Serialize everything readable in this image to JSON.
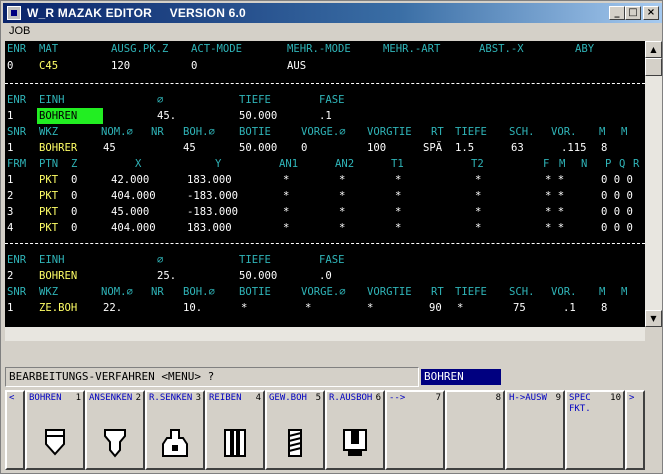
{
  "window": {
    "title": "W_R MAZAK EDITOR     VERSION 6.0",
    "min_glyph": "_",
    "max_glyph": "□",
    "close_glyph": "×"
  },
  "menu": {
    "job": "JOB"
  },
  "header": {
    "labels": [
      "ENR",
      "MAT",
      "AUSG.PK.Z",
      "ACT-MODE",
      "MEHR.-MODE",
      "MEHR.-ART",
      "ABST.-X",
      "ABY"
    ],
    "values": [
      "0",
      "C45",
      "120",
      "0",
      "AUS"
    ]
  },
  "unit1": {
    "head_labels": [
      "ENR",
      "EINH",
      "⌀",
      "TIEFE",
      "FASE"
    ],
    "head_values": [
      "1",
      "BOHREN",
      "45.",
      "50.000",
      ".1"
    ],
    "tool_labels": [
      "SNR",
      "WKZ",
      "NOM.⌀",
      "NR",
      "BOH.⌀",
      "BOTIE",
      "VORGE.⌀",
      "VORGTIE",
      "RT",
      "TIEFE",
      "SCH.",
      "VOR.",
      "M",
      "M"
    ],
    "tool_values": [
      "1",
      "BOHRER",
      "45",
      "45",
      "50.000",
      "0",
      "100",
      "SPÄ",
      "1.5",
      "63",
      ".115",
      "8"
    ],
    "fig_labels": [
      "FRM",
      "PTN",
      "Z",
      "X",
      "Y",
      "AN1",
      "AN2",
      "T1",
      "T2",
      "F",
      "M",
      "N",
      "P",
      "Q",
      "R"
    ],
    "fig_rows": [
      [
        "1",
        "PKT",
        "0",
        "42.000",
        "183.000",
        "*",
        "*",
        "*",
        "*",
        "* *",
        "0 0 0"
      ],
      [
        "2",
        "PKT",
        "0",
        "404.000",
        "-183.000",
        "*",
        "*",
        "*",
        "*",
        "* *",
        "0 0 0"
      ],
      [
        "3",
        "PKT",
        "0",
        "45.000",
        "-183.000",
        "*",
        "*",
        "*",
        "*",
        "* *",
        "0 0 0"
      ],
      [
        "4",
        "PKT",
        "0",
        "404.000",
        "183.000",
        "*",
        "*",
        "*",
        "*",
        "* *",
        "0 0 0"
      ]
    ]
  },
  "unit2": {
    "head_labels": [
      "ENR",
      "EINH",
      "⌀",
      "TIEFE",
      "FASE"
    ],
    "head_values": [
      "2",
      "BOHREN",
      "25.",
      "50.000",
      ".0"
    ],
    "tool_labels": [
      "SNR",
      "WKZ",
      "NOM.⌀",
      "NR",
      "BOH.⌀",
      "BOTIE",
      "VORGE.⌀",
      "VORGTIE",
      "RT",
      "TIEFE",
      "SCH.",
      "VOR.",
      "M",
      "M"
    ],
    "tool_values": [
      "1",
      "ZE.BOH",
      "22.",
      "10.",
      "*",
      "*",
      "*",
      "90",
      "*",
      "75",
      ".1",
      "8"
    ]
  },
  "prompt": {
    "text": "BEARBEITUNGS-VERFAHREN <MENU> ?",
    "answer": "BOHREN"
  },
  "softkeys": [
    {
      "label": "<",
      "num": "",
      "icon": ""
    },
    {
      "label": "BOHREN",
      "num": "1",
      "icon": "drill-icon"
    },
    {
      "label": "ANSENKEN",
      "num": "2",
      "icon": "countersink-icon"
    },
    {
      "label": "R.SENKEN",
      "num": "3",
      "icon": "counterbore-icon"
    },
    {
      "label": "REIBEN",
      "num": "4",
      "icon": "reamer-icon"
    },
    {
      "label": "GEW.BOH",
      "num": "5",
      "icon": "tap-icon"
    },
    {
      "label": "R.AUSBOH",
      "num": "6",
      "icon": "boring-icon"
    },
    {
      "label": "-->",
      "num": "7",
      "icon": ""
    },
    {
      "label": "",
      "num": "8",
      "icon": ""
    },
    {
      "label": "H->AUSW",
      "num": "9",
      "icon": ""
    },
    {
      "label": "SPEC\nFKT.",
      "num": "10",
      "icon": ""
    },
    {
      "label": ">",
      "num": "",
      "icon": ""
    }
  ]
}
